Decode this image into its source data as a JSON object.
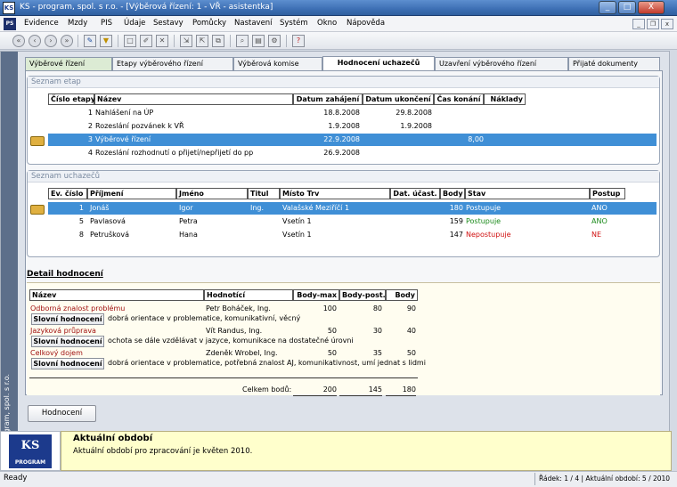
{
  "window": {
    "title": "KS - program, spol. s r.o. - [Výběrová řízení: 1 - VŘ - asistentka]",
    "min": "_",
    "max": "□",
    "close": "X"
  },
  "menu": [
    "Evidence",
    "Mzdy",
    "PIS",
    "Údaje",
    "Sestavy",
    "Pomůcky",
    "Nastavení",
    "Systém",
    "Okno",
    "Nápověda"
  ],
  "mdi_controls": [
    "_",
    "❐",
    "x"
  ],
  "toolbar_icons": [
    "first-icon",
    "prev-icon",
    "next-icon",
    "last-icon",
    "edit-icon",
    "filter-icon",
    "new-icon",
    "edit-doc-icon",
    "delete-icon",
    "import-icon",
    "export-icon",
    "copy-icon",
    "search-icon",
    "print-icon",
    "settings-icon",
    "help-icon"
  ],
  "sidestrip": "KS - program, spol. s r.o.",
  "tabs": [
    "Výběrové řízení",
    "Etapy výběrového řízení",
    "Výběrová komise",
    "Hodnocení uchazečů",
    "Uzavření výběrového řízení",
    "Přijaté dokumenty"
  ],
  "etapy": {
    "title": "Seznam etap",
    "headers": [
      "Číslo etapy",
      "Název",
      "Datum zahájení",
      "Datum ukončení",
      "Čas konání",
      "Náklady"
    ],
    "rows": [
      {
        "num": "1",
        "name": "Nahlášení na ÚP",
        "start": "18.8.2008",
        "end": "29.8.2008",
        "time": "",
        "cost": ""
      },
      {
        "num": "2",
        "name": "Rozeslání pozvánek k VŘ",
        "start": "1.9.2008",
        "end": "1.9.2008",
        "time": "",
        "cost": ""
      },
      {
        "num": "3",
        "name": "Výběrové řízení",
        "start": "22.9.2008",
        "end": "",
        "time": "8,00",
        "cost": ""
      },
      {
        "num": "4",
        "name": "Rozeslání rozhodnutí o přijetí/nepřijetí do pp",
        "start": "26.9.2008",
        "end": "",
        "time": "",
        "cost": ""
      }
    ]
  },
  "uchazeci": {
    "title": "Seznam uchazečů",
    "headers": [
      "Ev. číslo",
      "Příjmení",
      "Jméno",
      "Titul",
      "Místo Trv",
      "Dat. účast.",
      "Body",
      "Stav",
      "Postup"
    ],
    "rows": [
      {
        "num": "1",
        "surname": "Jonáš",
        "name": "Igor",
        "titul": "Ing.",
        "place": "Valašské Meziříčí 1",
        "date": "",
        "body": "180",
        "stav": "Postupuje",
        "postup": "ANO"
      },
      {
        "num": "5",
        "surname": "Pavlasová",
        "name": "Petra",
        "titul": "",
        "place": "Vsetín 1",
        "date": "",
        "body": "159",
        "stav": "Postupuje",
        "postup": "ANO"
      },
      {
        "num": "8",
        "surname": "Petrušková",
        "name": "Hana",
        "titul": "",
        "place": "Vsetín 1",
        "date": "",
        "body": "147",
        "stav": "Nepostupuje",
        "postup": "NE"
      }
    ]
  },
  "detail": {
    "title": "Detail hodnocení",
    "headers": [
      "Název",
      "Hodnotící",
      "Body-max",
      "Body-post.",
      "Body"
    ],
    "items": [
      {
        "name": "Odborná znalost problému",
        "evaluator": "Petr Boháček, Ing.",
        "max": "100",
        "post": "80",
        "body": "90",
        "btn": "Slovní hodnocení",
        "comment": "dobrá orientace v problematice, komunikativní, věcný"
      },
      {
        "name": "Jazyková průprava",
        "evaluator": "Vít Randus, Ing.",
        "max": "50",
        "post": "30",
        "body": "40",
        "btn": "Slovní hodnocení",
        "comment": "ochota se dále vzdělávat v jazyce, komunikace na dostatečné úrovni"
      },
      {
        "name": "Celkový dojem",
        "evaluator": "Zdeněk Wrobel, Ing.",
        "max": "50",
        "post": "35",
        "body": "50",
        "btn": "Slovní hodnocení",
        "comment": "dobrá orientace v problematice, potřebná znalost AJ, komunikativnost, umí jednat s lidmi"
      }
    ],
    "total_label": "Celkem bodů:",
    "total_max": "200",
    "total_post": "145",
    "total_body": "180"
  },
  "hodnoceni_button": "Hodnocení",
  "logo": {
    "main": "KS",
    "sub": "PROGRAM"
  },
  "info": {
    "title": "Aktuální období",
    "text": "Aktuální období pro zpracování je květen 2010."
  },
  "status": {
    "left": "Ready",
    "right": "Řádek: 1 / 4 | Aktuální období: 5 / 2010"
  }
}
